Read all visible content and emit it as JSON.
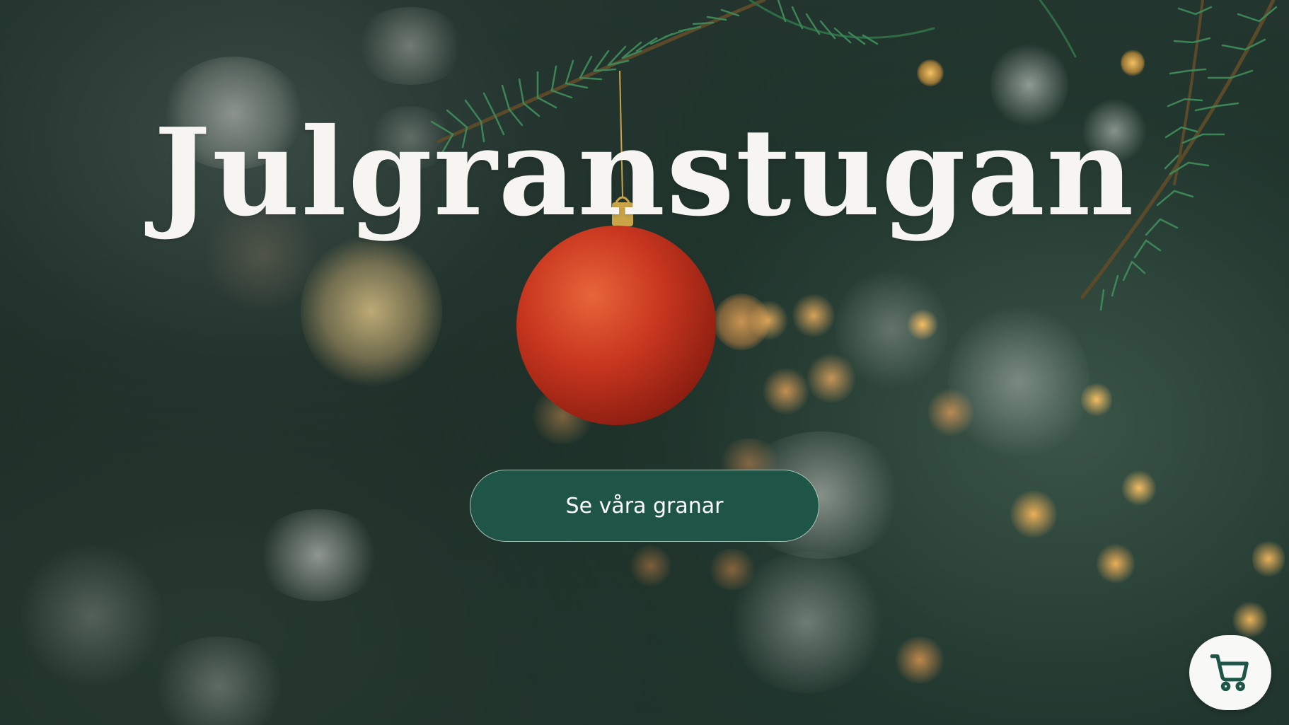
{
  "hero": {
    "title": "Julgranstugan",
    "cta_label": "Se våra granar"
  },
  "cart": {
    "icon": "shopping-cart-icon"
  },
  "colors": {
    "cta_background": "#1e5546",
    "title_text": "#f6f5f2",
    "cart_icon": "#1e5546",
    "cart_background": "#f8f8f6",
    "ornament": "#c8361f"
  }
}
